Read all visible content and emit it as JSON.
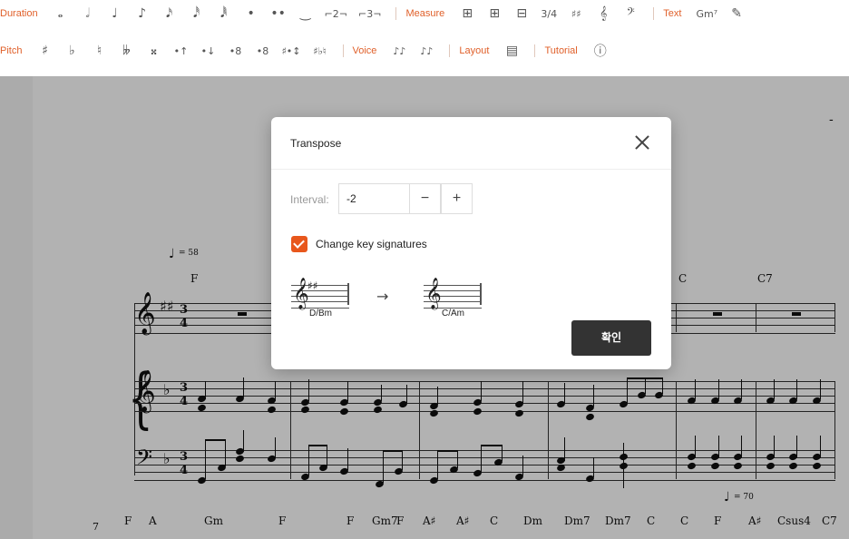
{
  "toolbar": {
    "row1": {
      "duration_label": "Duration",
      "duration_items": [
        "𝅝",
        "𝅗𝅥",
        "♩",
        "♪",
        "𝅘𝅥𝅯",
        "𝅘𝅥𝅰",
        "𝅘𝅥𝅱",
        "•",
        "••",
        "‿",
        "⌐2¬",
        "⌐3¬"
      ],
      "measure_label": "Measure",
      "measure_items": [
        "⊞",
        "⊞",
        "⊟"
      ],
      "time_sig": "3/4",
      "key_sig": "♯♯",
      "treble": "𝄞",
      "bass": "𝄢",
      "text_label": "Text",
      "chord_label": "Gm⁷"
    },
    "row2": {
      "pitch_label": "Pitch",
      "pitch_items": [
        "♯",
        "♭",
        "♮",
        "𝄫",
        "𝄪",
        "•↑",
        "•↓",
        "•8",
        "•8",
        "♯•↕",
        "♯♭♮"
      ],
      "voice_label": "Voice",
      "voice_items": [
        "♪♪",
        "♪♪"
      ],
      "layout_label": "Layout",
      "tutorial_label": "Tutorial",
      "tutorial_icon": "ⓘ"
    }
  },
  "score": {
    "tempo1": "= 58",
    "tempo2": "= 70",
    "chord_top": [
      "F",
      "C",
      "C7"
    ],
    "chord_bottom": [
      "F",
      "A",
      "Gm",
      "F",
      "F",
      "Gm7",
      "F",
      "A♯",
      "A♯",
      "C",
      "Dm",
      "Dm7",
      "Dm7",
      "C",
      "C",
      "F",
      "A♯",
      "Csus4",
      "C7"
    ],
    "measure_number": "7",
    "time_signature": "3/4",
    "treble_clef": "𝄞",
    "bass_clef": "𝄢",
    "brace": "{",
    "dash": "-"
  },
  "dialog": {
    "title": "Transpose",
    "interval_label": "Interval:",
    "interval_value": "-2",
    "minus": "−",
    "plus": "+",
    "checkbox_checked": true,
    "checkbox_label": "Change key signatures",
    "from_key": "D/Bm",
    "from_acc": "♯♯",
    "to_key": "C/Am",
    "arrow": "→",
    "confirm": "확인",
    "accent_color": "#e8571c"
  }
}
